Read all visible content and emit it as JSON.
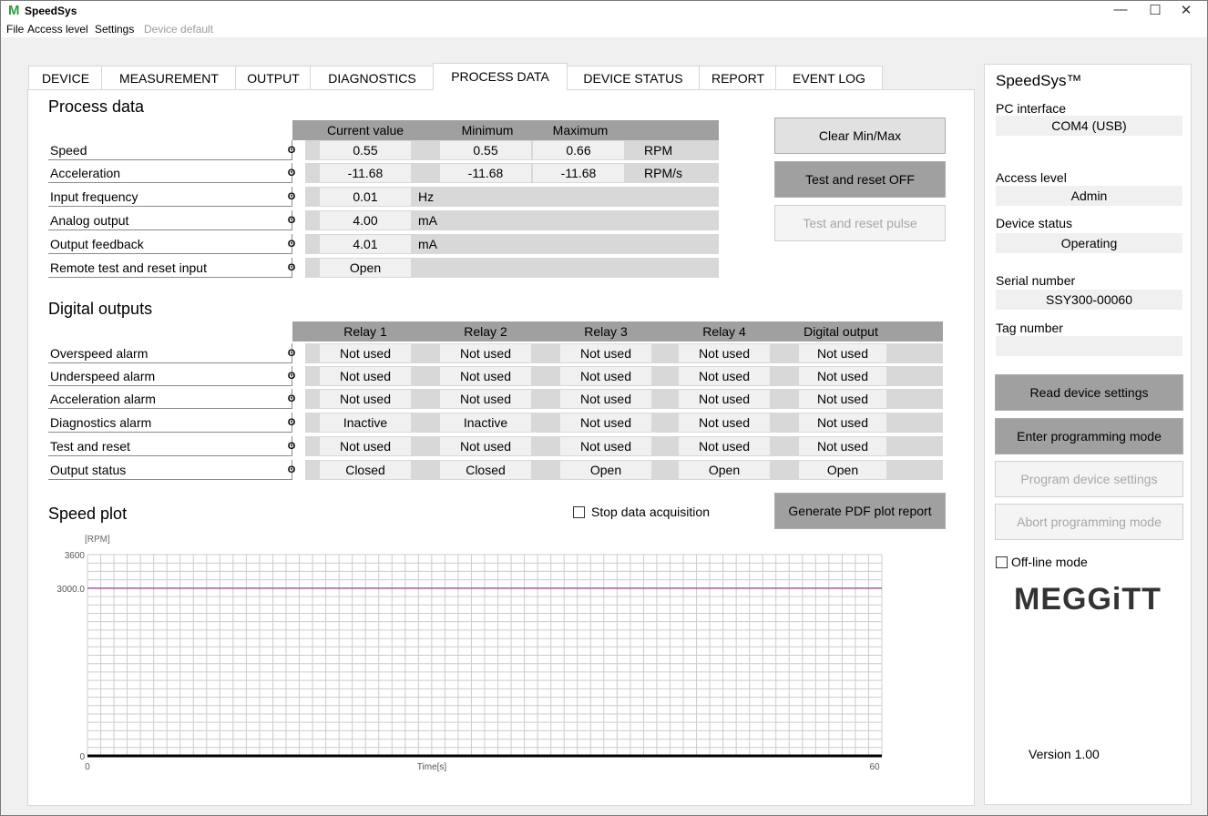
{
  "app": {
    "logo": "M",
    "title": "SpeedSys"
  },
  "window_controls": {
    "minimize": "—",
    "maximize": "☐",
    "close": "✕"
  },
  "menu": {
    "items": [
      "File",
      "Access level",
      "Settings",
      "Device default"
    ]
  },
  "tabs": [
    "DEVICE",
    "MEASUREMENT",
    "OUTPUT",
    "DIAGNOSTICS",
    "PROCESS DATA",
    "DEVICE STATUS",
    "REPORT",
    "EVENT LOG"
  ],
  "active_tab": "PROCESS DATA",
  "process_data": {
    "title": "Process data",
    "headers": [
      "Current value",
      "Minimum",
      "Maximum"
    ],
    "info_glyph": "ʘ",
    "rows": [
      {
        "label": "Speed",
        "current": "0.55",
        "min": "0.55",
        "max": "0.66",
        "unit": "RPM"
      },
      {
        "label": "Acceleration",
        "current": "-11.68",
        "min": "-11.68",
        "max": "-11.68",
        "unit": "RPM/s"
      },
      {
        "label": "Input frequency",
        "current": "0.01",
        "unit": "Hz"
      },
      {
        "label": "Analog output",
        "current": "4.00",
        "unit": "mA"
      },
      {
        "label": "Output feedback",
        "current": "4.01",
        "unit": "mA"
      },
      {
        "label": "Remote test and reset input",
        "current": "Open",
        "unit": ""
      }
    ],
    "buttons": {
      "clear": "Clear Min/Max",
      "test_reset_off": "Test and reset OFF",
      "test_reset_pulse": "Test and reset pulse"
    }
  },
  "digital_outputs": {
    "title": "Digital outputs",
    "headers": [
      "Relay 1",
      "Relay 2",
      "Relay 3",
      "Relay 4",
      "Digital output"
    ],
    "rows": [
      {
        "label": "Overspeed alarm",
        "values": [
          "Not used",
          "Not used",
          "Not used",
          "Not used",
          "Not used"
        ]
      },
      {
        "label": "Underspeed alarm",
        "values": [
          "Not used",
          "Not used",
          "Not used",
          "Not used",
          "Not used"
        ]
      },
      {
        "label": "Acceleration alarm",
        "values": [
          "Not used",
          "Not used",
          "Not used",
          "Not used",
          "Not used"
        ]
      },
      {
        "label": "Diagnostics alarm",
        "values": [
          "Inactive",
          "Inactive",
          "Not used",
          "Not used",
          "Not used"
        ]
      },
      {
        "label": "Test and reset",
        "values": [
          "Not used",
          "Not used",
          "Not used",
          "Not used",
          "Not used"
        ]
      },
      {
        "label": "Output status",
        "values": [
          "Closed",
          "Closed",
          "Open",
          "Open",
          "Open"
        ]
      }
    ]
  },
  "speed_plot": {
    "title": "Speed plot",
    "stop_label": "Stop data acquisition",
    "stop_checked": false,
    "pdf_button": "Generate PDF plot report",
    "unit_label": "[RPM]",
    "y_ticks": [
      "3600",
      "3000.0",
      "0"
    ],
    "x_ticks": [
      "0",
      "60"
    ],
    "xlabel": "Time[s]",
    "y_max": 3600,
    "x_max": 60,
    "limit_line_value": 3000.0,
    "speed_value": 0.55,
    "colors": {
      "limit": "#a05aa5",
      "grid": "#cccccc",
      "speed": "#000000"
    }
  },
  "side": {
    "title": "SpeedSys™",
    "pc_interface_label": "PC interface",
    "pc_interface_value": "COM4 (USB)",
    "access_level_label": "Access level",
    "access_level_value": "Admin",
    "device_status_label": "Device status",
    "device_status_value": "Operating",
    "serial_label": "Serial number",
    "serial_value": "SSY300-00060",
    "tag_label": "Tag number",
    "tag_value": "",
    "buttons": {
      "read": "Read device settings",
      "enter": "Enter programming mode",
      "program": "Program device settings",
      "abort": "Abort programming mode"
    },
    "offline_label": "Off-line mode",
    "offline_checked": false,
    "brand": "MEGGiTT",
    "version": "Version 1.00"
  }
}
